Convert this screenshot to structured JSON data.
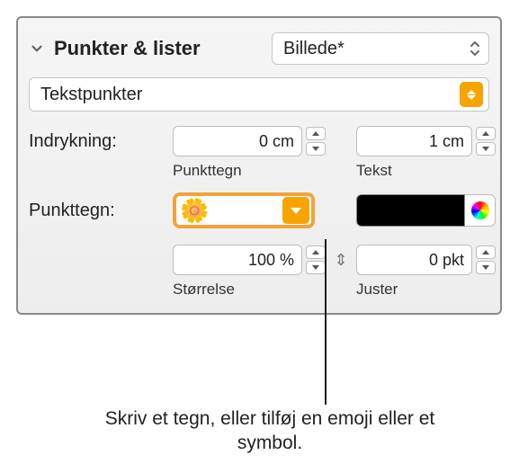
{
  "header": {
    "title": "Punkter & lister",
    "style_label": "Billede*"
  },
  "type_popup": {
    "label": "Tekstpunkter"
  },
  "labels": {
    "indent": "Indrykning:",
    "bullet_text": "Punkttegn:",
    "bullet_sub": "Punkttegn",
    "text_sub": "Tekst",
    "size_sub": "Størrelse",
    "align_sub": "Juster"
  },
  "values": {
    "bullet_indent": "0 cm",
    "text_indent": "1 cm",
    "size": "100 %",
    "align": "0 pkt"
  },
  "caption": "Skriv et tegn, eller tilføj en emoji eller et symbol."
}
